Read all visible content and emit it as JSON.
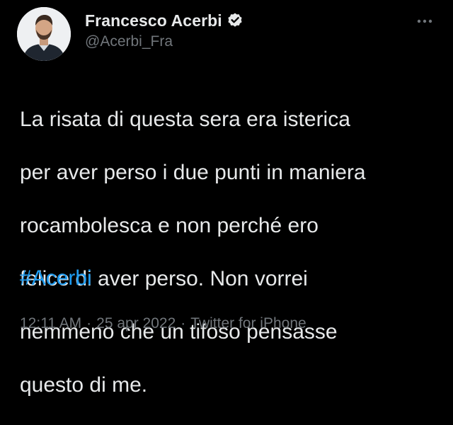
{
  "author": {
    "display_name": "Francesco Acerbi",
    "handle": "@Acerbi_Fra",
    "verified": true,
    "avatar_icon": "profile-photo-icon"
  },
  "tweet": {
    "text_lines": [
      "La risata di questa sera era isterica",
      "per aver perso i due punti in maniera",
      "rocambolesca e non perché ero",
      "felice di aver perso. Non vorrei",
      "nemmeno che un tifoso pensasse",
      "questo di me."
    ],
    "hashtag": "#Acerbi",
    "time": "12:11 AM",
    "separator": "·",
    "date": "25 apr 2022",
    "source": "Twitter for iPhone"
  },
  "icons": {
    "more": "more-options-icon",
    "verified": "verified-badge-icon"
  },
  "colors": {
    "background": "#000000",
    "text": "#e7e9ea",
    "secondary": "#71767b",
    "link": "#1d9bf0"
  }
}
